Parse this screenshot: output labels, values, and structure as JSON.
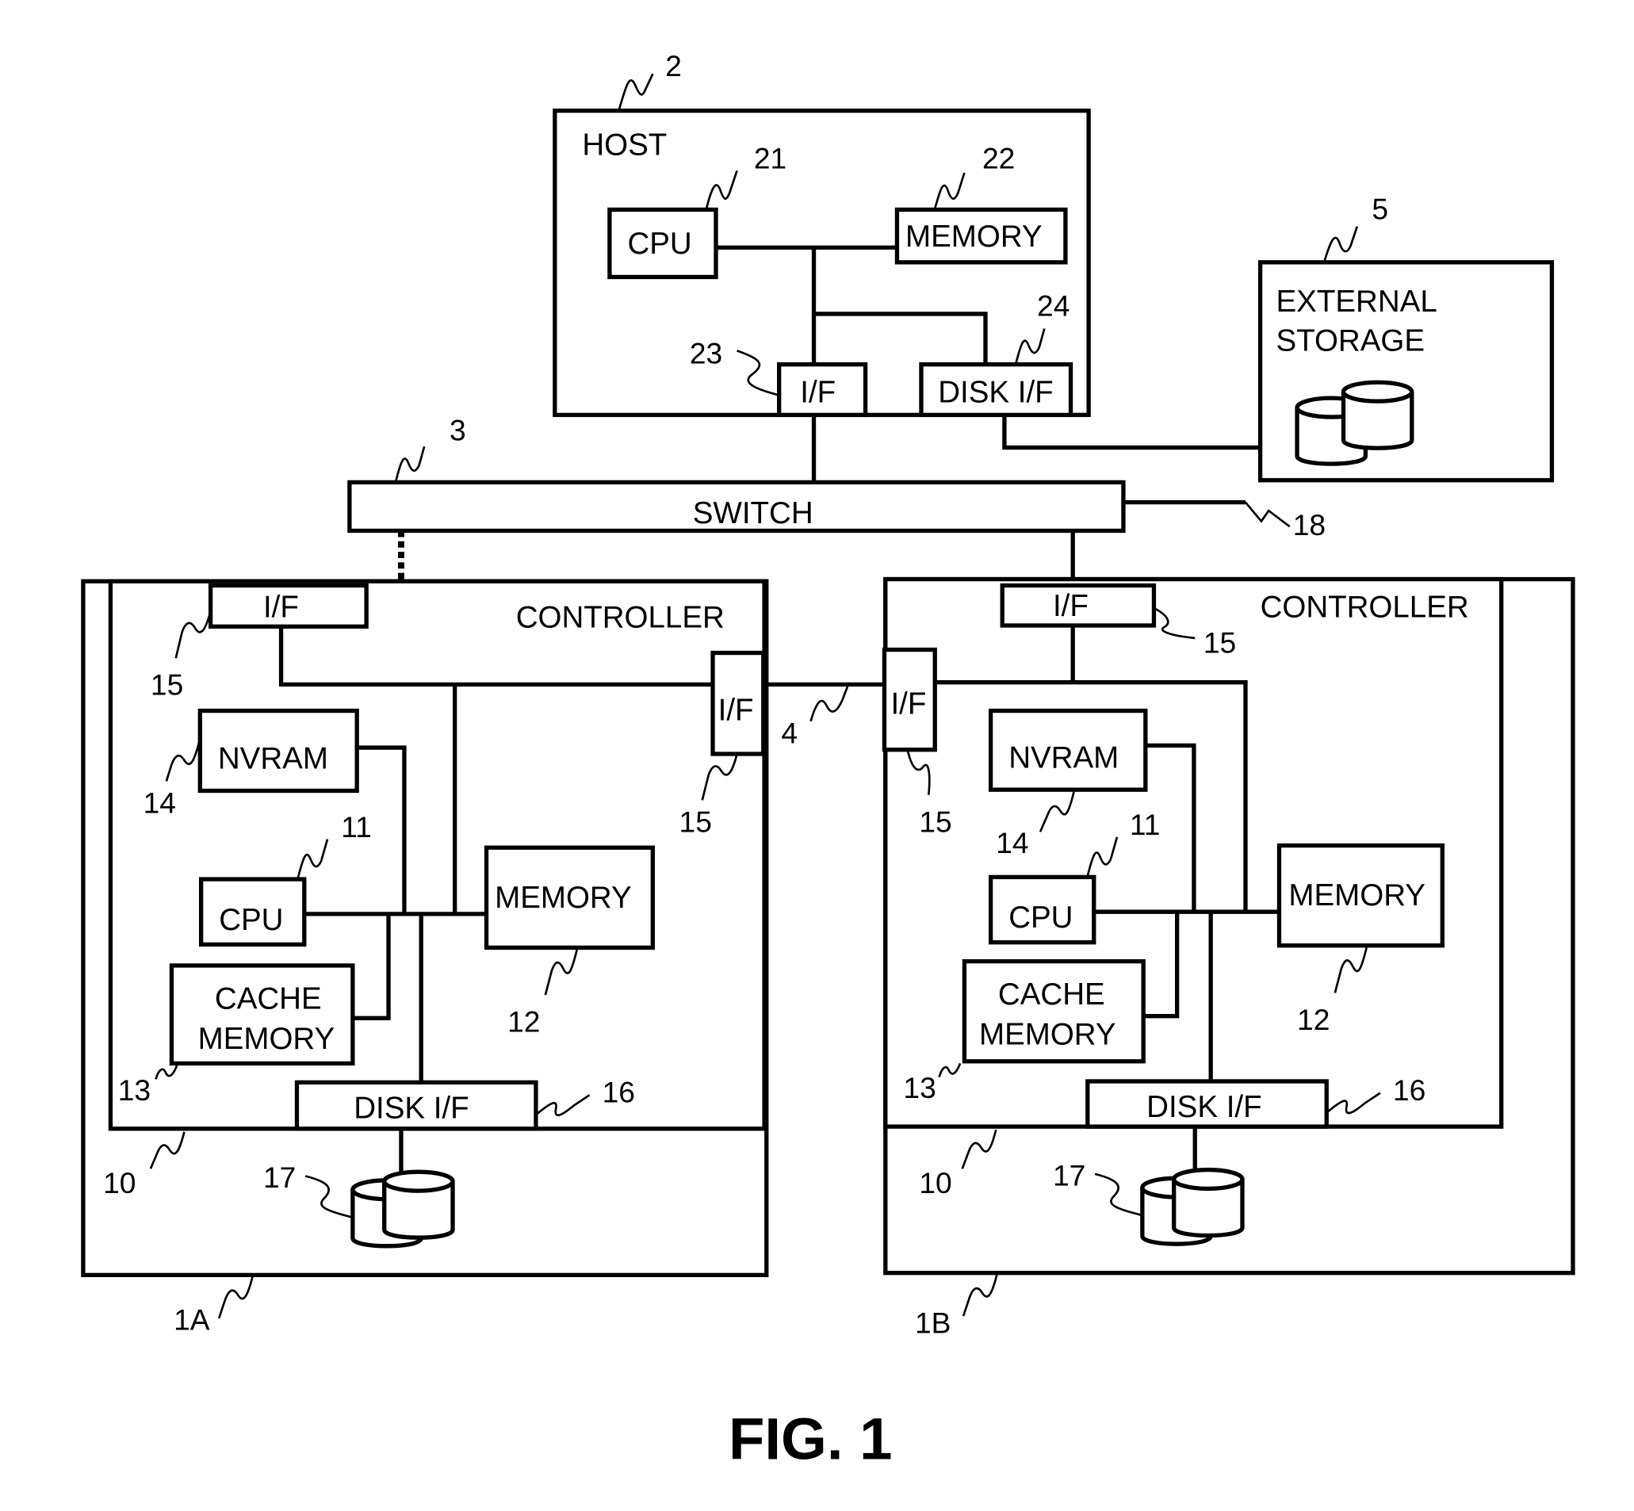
{
  "figure": {
    "caption": "FIG. 1"
  },
  "host": {
    "label": "HOST",
    "ref": "2",
    "cpu": {
      "label": "CPU",
      "ref": "21"
    },
    "memory": {
      "label": "MEMORY",
      "ref": "22"
    },
    "interface": {
      "label": "I/F",
      "ref": "23"
    },
    "disk_interface": {
      "label": "DISK I/F",
      "ref": "24"
    }
  },
  "external_storage": {
    "label_line1": "EXTERNAL",
    "label_line2": "STORAGE",
    "ref": "5"
  },
  "switch": {
    "label": "SWITCH",
    "ref": "3",
    "port_ref": "18"
  },
  "link_ref": "4",
  "storage_a": {
    "ref": "1A",
    "controller": {
      "label": "CONTROLLER",
      "ref": "10",
      "if_top": {
        "label": "I/F",
        "ref": "15"
      },
      "if_side": {
        "label": "I/F",
        "ref": "15"
      },
      "nvram": {
        "label": "NVRAM",
        "ref": "14"
      },
      "cpu": {
        "label": "CPU",
        "ref": "11"
      },
      "memory": {
        "label": "MEMORY",
        "ref": "12"
      },
      "cache": {
        "label_line1": "CACHE",
        "label_line2": "MEMORY",
        "ref": "13"
      },
      "disk_if": {
        "label": "DISK I/F",
        "ref": "16"
      }
    },
    "disks_ref": "17"
  },
  "storage_b": {
    "ref": "1B",
    "controller": {
      "label": "CONTROLLER",
      "ref": "10",
      "if_top": {
        "label": "I/F",
        "ref": "15"
      },
      "if_side": {
        "label": "I/F",
        "ref": "15"
      },
      "nvram": {
        "label": "NVRAM",
        "ref": "14"
      },
      "cpu": {
        "label": "CPU",
        "ref": "11"
      },
      "memory": {
        "label": "MEMORY",
        "ref": "12"
      },
      "cache": {
        "label_line1": "CACHE",
        "label_line2": "MEMORY",
        "ref": "13"
      },
      "disk_if": {
        "label": "DISK I/F",
        "ref": "16"
      }
    },
    "disks_ref": "17"
  }
}
